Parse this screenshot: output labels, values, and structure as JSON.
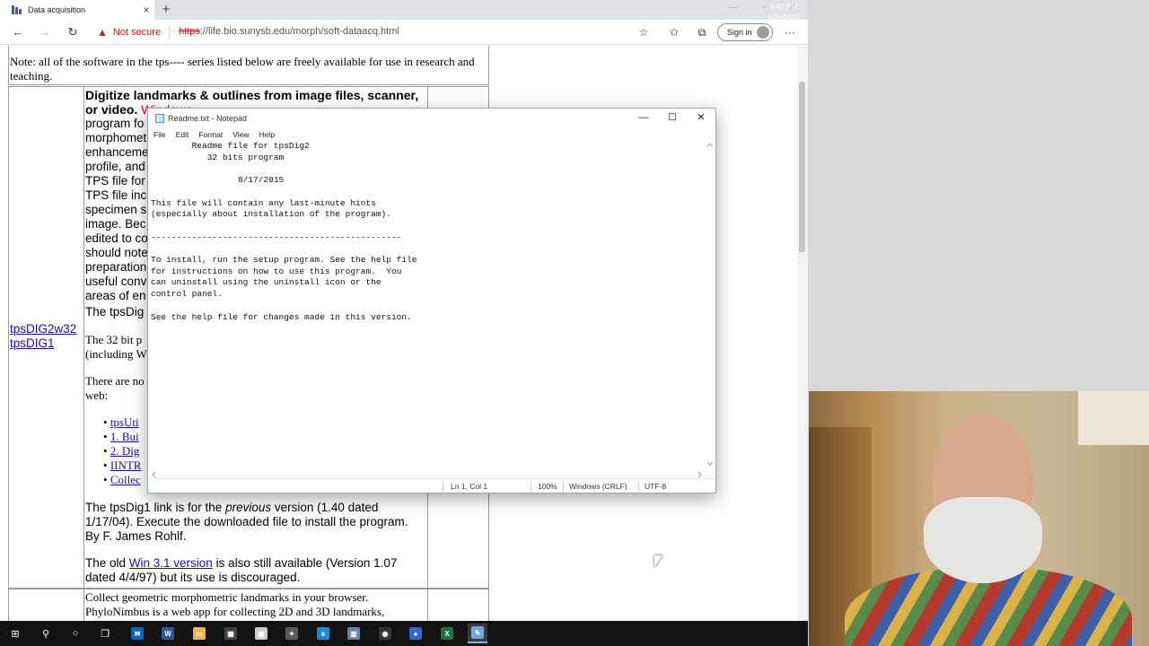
{
  "browser": {
    "tab_title": "Data acquisition",
    "tab_close": "×",
    "new_tab": "+",
    "window_controls": {
      "minimize": "—",
      "maximize": "▫",
      "close": "✕"
    },
    "nav": {
      "back": "←",
      "forward": "→",
      "refresh": "↻"
    },
    "security_label": "Not secure",
    "url_scheme": "https",
    "url_rest": "://life.bio.sunysb.edu/morph/soft-dataacq.html",
    "signin_label": "Sign in",
    "more_label": "···"
  },
  "webpage": {
    "note": "Note: all of the software in the tps---- series listed below are freely available for use in research and teaching.",
    "heading_line1": "Digitize landmarks & outlines from image files, scanner,",
    "heading_line2_bold": "or video.",
    "heading_line2_red": "Windows",
    "left_lines": [
      "program fo",
      "morphomet",
      "enhanceme",
      "profile, and",
      "TPS file for",
      "TPS file inc",
      "specimen s",
      "image. Bec",
      "edited to co",
      "should note",
      "preparation",
      "useful conv",
      "areas of en",
      "The tpsDig"
    ],
    "links_left": [
      "tpsDIG2w32",
      "tpsDIG1"
    ],
    "para_32bit": [
      "The 32 bit p",
      "(including W"
    ],
    "para_there": [
      "There are no",
      "web:"
    ],
    "list_links": [
      "tpsUti",
      "1. Bui",
      "2. Dig",
      "IINTR",
      "Collec"
    ],
    "para_tpsdig1_pre": "The tpsDig1 link is for the ",
    "para_tpsdig1_ital": "previous",
    "para_tpsdig1_post": " version (1.40 dated",
    "para_tpsdig1_line2": "1/17/04). Execute the downloaded file to install the program.",
    "para_tpsdig1_line3": "By F. James Rohlf.",
    "para_old_pre": "The old ",
    "para_old_link": "Win 3.1 version",
    "para_old_post": " is also still available (Version 1.07",
    "para_old_line2": "dated 4/4/97) but its use is discouraged.",
    "bottom_line1": "Collect geometric morphometric landmarks in your browser.",
    "bottom_line2": "PhyloNimbus is a web app for collecting 2D and 3D landmarks,"
  },
  "notepad": {
    "title": "Readme.txt - Notepad",
    "window_controls": {
      "minimize": "—",
      "maximize": "☐",
      "close": "✕"
    },
    "menu": [
      "File",
      "Edit",
      "Format",
      "View",
      "Help"
    ],
    "content": "        Readme file for tpsDig2\n           32 bits program\n\n                 8/17/2015\n\nThis file will contain any last-minute hints\n(especially about installation of the program).\n\n-------------------------------------------------\n\nTo install, run the setup program. See the help file\nfor instructions on how to use this program.  You\ncan uninstall using the uninstall icon or the\ncontrol panel.\n\nSee the help file for changes made in this version.",
    "status": {
      "position": "Ln 1, Col 1",
      "zoom": "100%",
      "line_ending": "Windows (CRLF)",
      "encoding": "UTF-8"
    }
  },
  "taskbar": {
    "time": "6:42 PM",
    "date": "8/26/2020",
    "apps": [
      {
        "name": "start-icon",
        "glyph": "⊞"
      },
      {
        "name": "search-icon",
        "glyph": "⚲"
      },
      {
        "name": "cortana-icon",
        "glyph": "○"
      },
      {
        "name": "task-view-icon",
        "glyph": "❐"
      },
      {
        "name": "mail-icon",
        "glyph": "✉",
        "color": "#0a64c8"
      },
      {
        "name": "word-icon",
        "glyph": "W",
        "color": "#2b579a"
      },
      {
        "name": "file-explorer-icon",
        "glyph": "▭",
        "color": "#e8b64a"
      },
      {
        "name": "calculator-icon",
        "glyph": "▦",
        "color": "#444444"
      },
      {
        "name": "store-icon",
        "glyph": "▣",
        "color": "#cccccc"
      },
      {
        "name": "image-app-icon",
        "glyph": "✦",
        "color": "#5a5a5a"
      },
      {
        "name": "edge-icon",
        "glyph": "e",
        "color": "#1e88d4"
      },
      {
        "name": "tps-app-icon",
        "glyph": "▥",
        "color": "#6b7fa8"
      },
      {
        "name": "camera-app-icon",
        "glyph": "◉",
        "color": "#333333"
      },
      {
        "name": "chrome-like-icon",
        "glyph": "●",
        "color": "#3367d6"
      },
      {
        "name": "excel-icon",
        "glyph": "X",
        "color": "#1e7145"
      },
      {
        "name": "notepad-icon",
        "glyph": "✎",
        "color": "#6fa8dc"
      }
    ]
  }
}
